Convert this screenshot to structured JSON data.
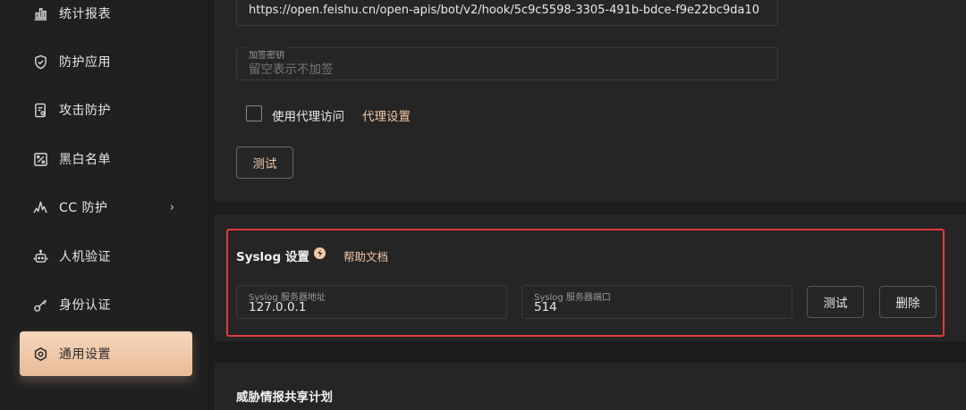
{
  "sidebar": {
    "items": [
      {
        "label": "统计报表",
        "icon": "bar-chart-icon"
      },
      {
        "label": "防护应用",
        "icon": "shield-icon"
      },
      {
        "label": "攻击防护",
        "icon": "attack-log-icon"
      },
      {
        "label": "黑白名单",
        "icon": "percent-list-icon"
      },
      {
        "label": "CC 防护",
        "icon": "pulse-icon",
        "chevron": "›"
      },
      {
        "label": "人机验证",
        "icon": "robot-icon"
      },
      {
        "label": "身份认证",
        "icon": "key-icon"
      },
      {
        "label": "通用设置",
        "icon": "gear-icon",
        "active": true
      }
    ]
  },
  "webhook": {
    "url_value": "https://open.feishu.cn/open-apis/bot/v2/hook/5c9c5598-3305-491b-bdce-f9e22bc9da10",
    "secret_label": "加签密钥",
    "secret_placeholder": "留空表示不加签",
    "proxy_checkbox_label": "使用代理访问",
    "proxy_settings_link": "代理设置",
    "test_button": "测试"
  },
  "syslog": {
    "title": "Syslog 设置",
    "help_link": "帮助文档",
    "address_label": "Syslog 服务器地址",
    "address_value": "127.0.0.1",
    "port_label": "Syslog 服务器端口",
    "port_value": "514",
    "test_button": "测试",
    "delete_button": "删除"
  },
  "threat_intel": {
    "title": "威胁情报共享计划"
  },
  "colors": {
    "accent": "#f2c9a8",
    "active_nav_start": "#f6d6bd",
    "active_nav_end": "#e9bb98",
    "highlight_border": "#e03c3c",
    "background": "#1c1c1c",
    "card": "#252525"
  }
}
